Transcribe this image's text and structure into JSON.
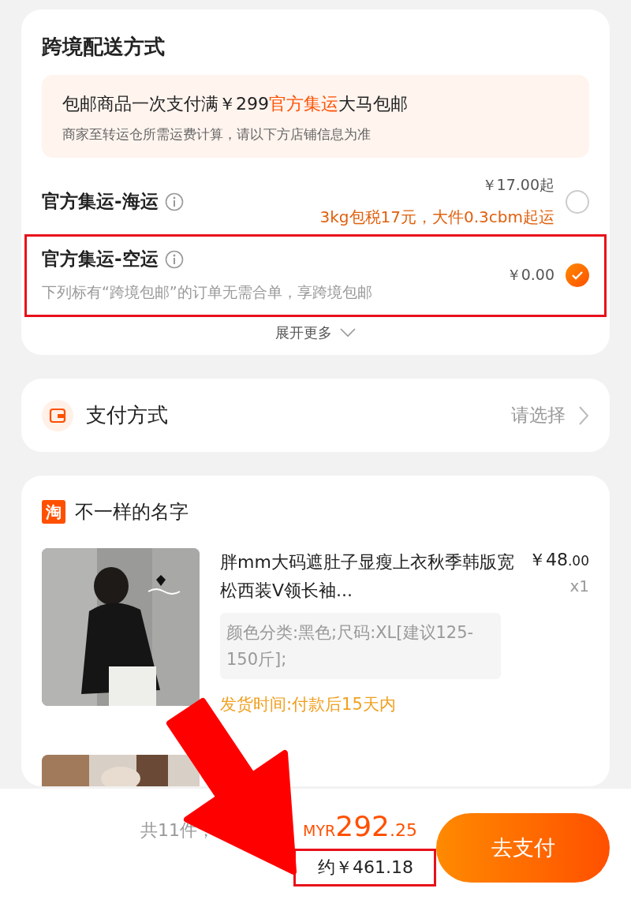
{
  "shipping": {
    "title": "跨境配送方式",
    "notice": {
      "line1_before": "包邮商品一次支付满￥299",
      "line1_highlight": "官方集运",
      "line1_after": "大马包邮",
      "line2": "商家至转运仓所需运费计算，请以下方店铺信息为准"
    },
    "options": [
      {
        "name": "官方集运-海运",
        "price": "￥17.00起",
        "note": "3kg包税17元，大件0.3cbm起运",
        "kind": "promo",
        "selected": false,
        "highlighted": false
      },
      {
        "name": "官方集运-空运",
        "price": "￥0.00",
        "note": "下列标有“跨境包邮”的订单无需合单，享跨境包邮",
        "kind": "plain",
        "selected": true,
        "highlighted": true
      }
    ],
    "expand": "展开更多"
  },
  "payment": {
    "label": "支付方式",
    "value": "请选择"
  },
  "shop": {
    "logo_text": "淘",
    "name": "不一样的名字",
    "items": [
      {
        "title": "胖mm大码遮肚子显瘦上衣秋季韩版宽松西装V领长袖...",
        "price_int": "￥48",
        "price_dec": ".00",
        "qty": "x1",
        "sku": "颜色分类:黑色;尺码:XL[建议125-150斤];",
        "delivery": "发货时间:付款后15天内"
      }
    ]
  },
  "footer": {
    "count": "共11件，",
    "currency": "MYR",
    "amount_int": "292",
    "amount_dec": ".25",
    "approx": "约￥461.18",
    "approx_highlighted": true,
    "button": "去支付"
  }
}
